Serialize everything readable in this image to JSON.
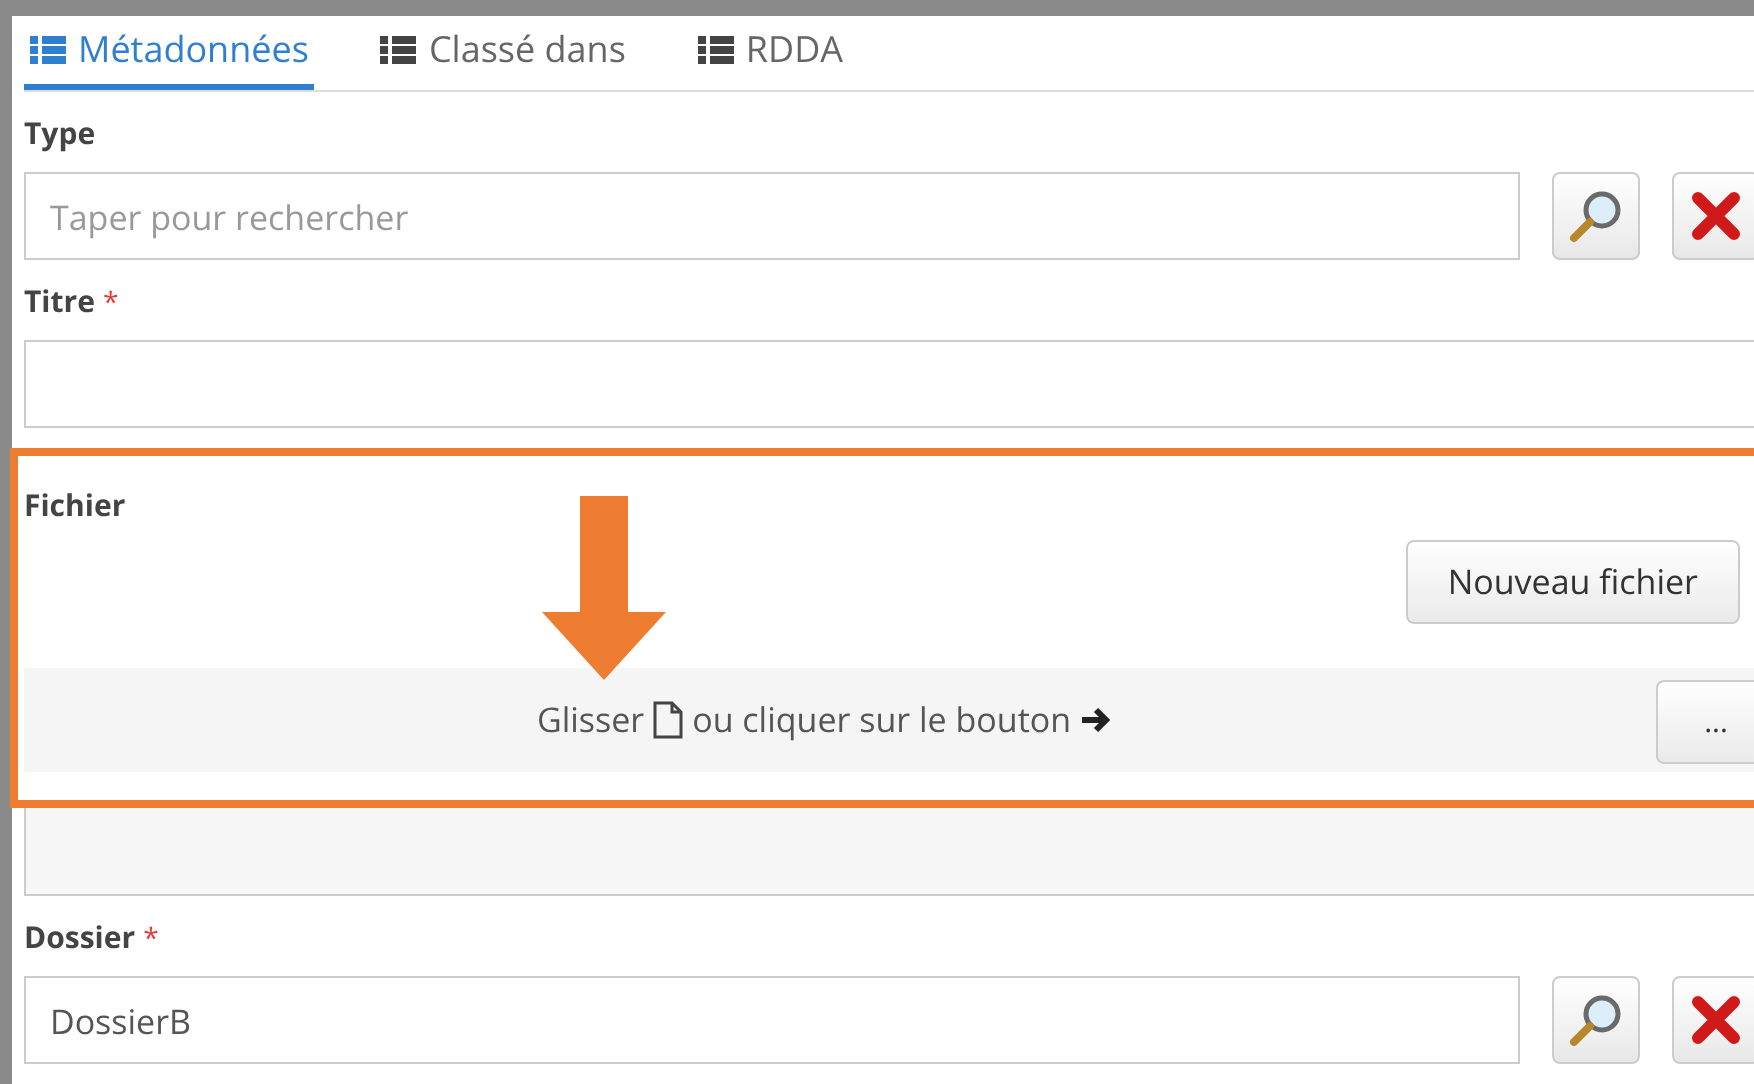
{
  "tabs": [
    {
      "label": "Métadonnées",
      "selected": true
    },
    {
      "label": "Classé dans",
      "selected": false
    },
    {
      "label": "RDDA",
      "selected": false
    }
  ],
  "fields": [
    {
      "kind": "lookup",
      "label": "Type",
      "placeholder": "Taper pour rechercher"
    },
    {
      "kind": "text",
      "label": "Titre",
      "required_mark": "*"
    },
    {
      "kind": "file",
      "label": "Fichier",
      "new_button": "Nouveau fichier",
      "drop_text_before": "Glisser",
      "drop_text_after": "ou cliquer sur le bouton",
      "browse_button": "..."
    },
    {
      "kind": "lookup",
      "label": "Dossier",
      "required_mark": "*",
      "value": "DossierB"
    }
  ]
}
